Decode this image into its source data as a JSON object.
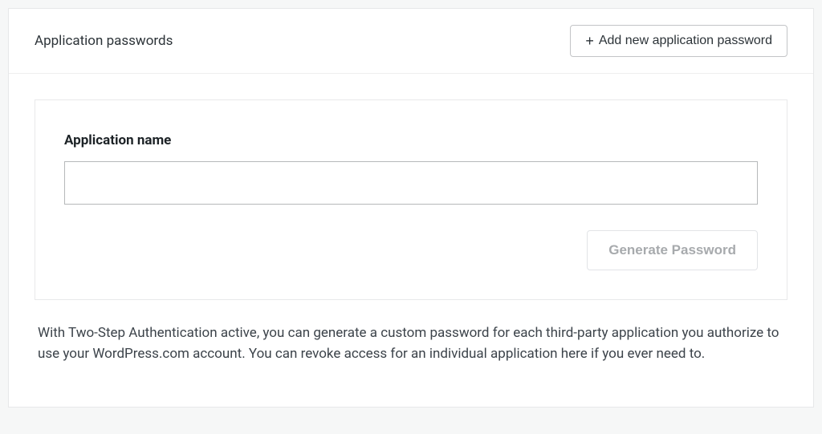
{
  "panel": {
    "title": "Application passwords",
    "add_button_label": "Add new application password"
  },
  "form": {
    "field_label": "Application name",
    "field_value": "",
    "generate_button_label": "Generate Password"
  },
  "description": "With Two-Step Authentication active, you can generate a custom password for each third-party application you authorize to use your WordPress.com account. You can revoke access for an individual application here if you ever need to."
}
